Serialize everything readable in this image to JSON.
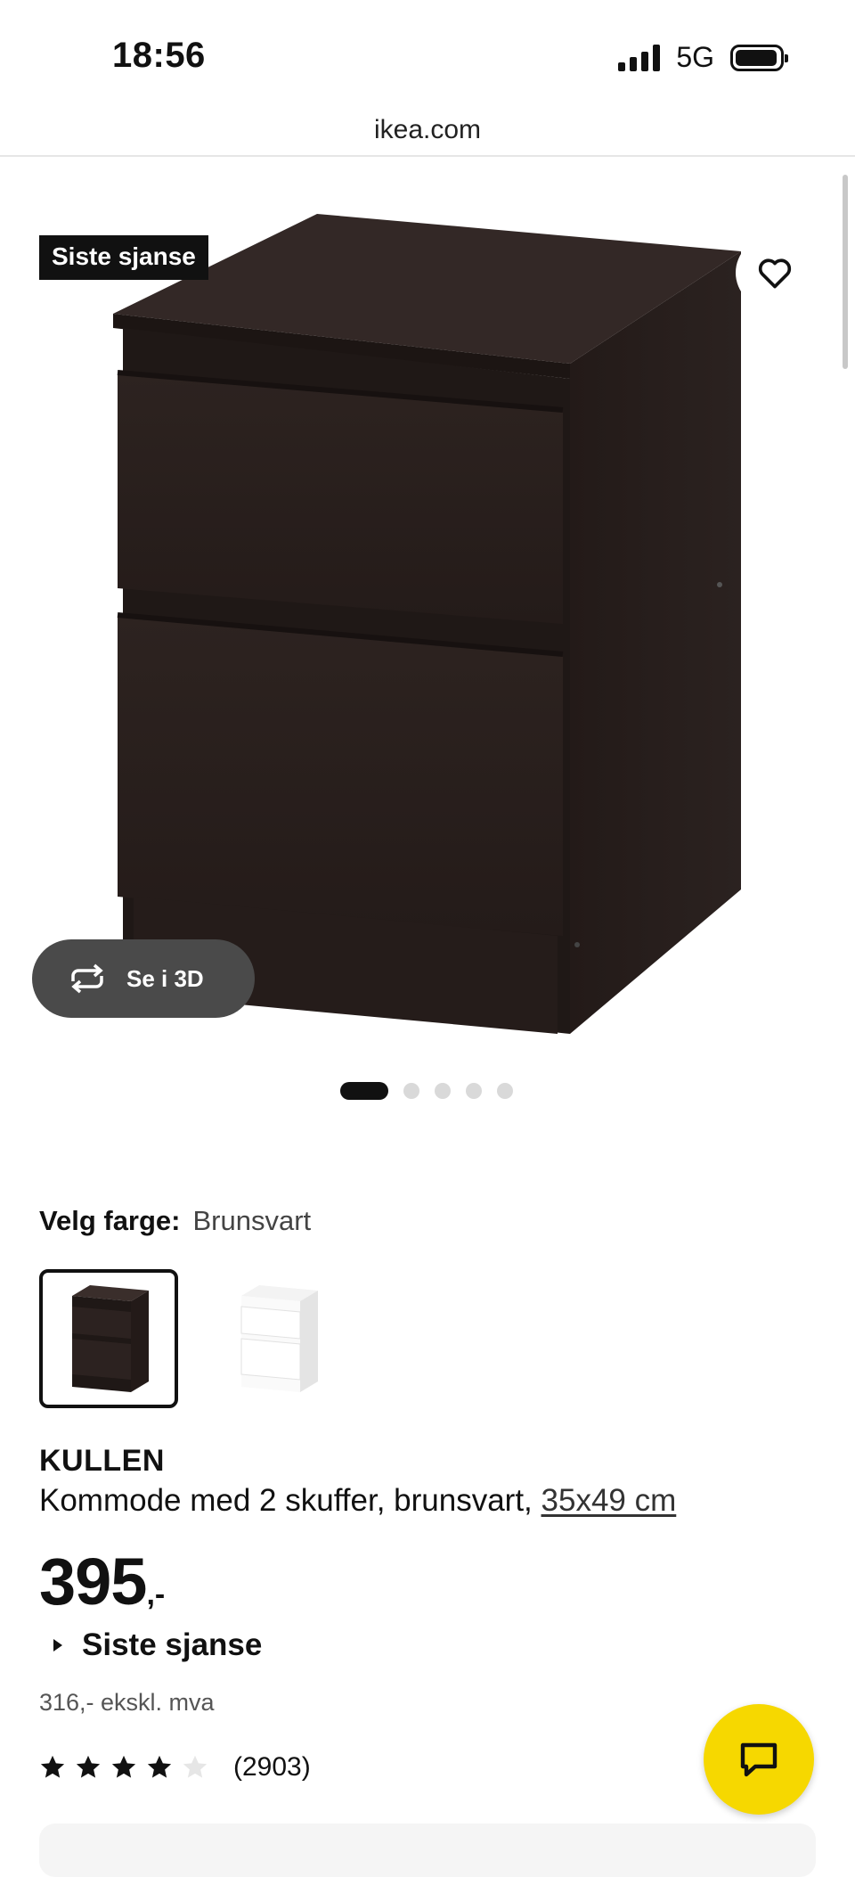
{
  "status_bar": {
    "time": "18:56",
    "network": "5G"
  },
  "browser": {
    "url": "ikea.com"
  },
  "hero": {
    "badge": "Siste sjanse",
    "view_3d_label": "Se i 3D",
    "favorite_icon": "heart-icon",
    "rotate_icon": "rotate-icon",
    "image_count": 5,
    "active_image": 1
  },
  "color": {
    "label": "Velg farge:",
    "value": "Brunsvart",
    "options": [
      "Brunsvart",
      "Hvit"
    ]
  },
  "product": {
    "name": "KULLEN",
    "description": "Kommode med 2 skuffer, brunsvart, ",
    "size": "35x49 cm",
    "price_integer": "395",
    "price_decimal": ",-",
    "price_note": "Siste sjanse",
    "price_excl_vat": "316,- ekskl. mva",
    "rating_value": 4,
    "rating_max": 5,
    "rating_count": "(2903)"
  },
  "chat": {
    "icon": "chat-icon"
  },
  "colors": {
    "brand_yellow": "#f6d800",
    "dark_wood": "#2a201d",
    "badge_bg": "#111111"
  }
}
